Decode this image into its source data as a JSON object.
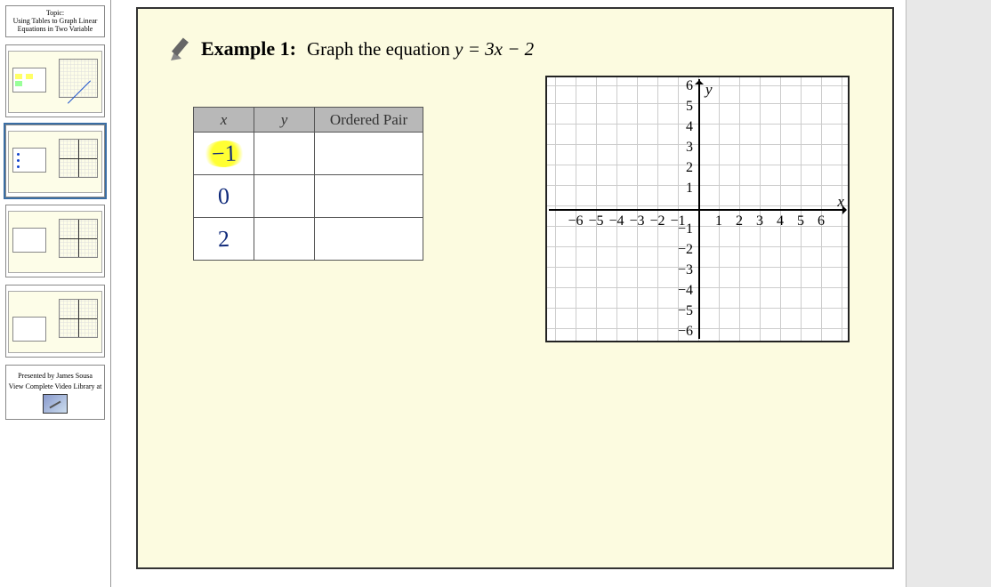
{
  "sidebar": {
    "topic_label": "Topic:",
    "topic_text": "Using Tables to Graph Linear Equations in Two Variable",
    "credits_presented_by": "Presented by James Sousa",
    "credits_view_library": "View Complete Video Library at"
  },
  "slide": {
    "example_label": "Example 1:",
    "example_prompt_prefix": "Graph the equation  ",
    "example_equation": "y = 3x − 2",
    "table": {
      "headers": {
        "x": "x",
        "y": "y",
        "ordered_pair": "Ordered Pair"
      },
      "rows": [
        {
          "x": "−1",
          "y": "",
          "pair": "",
          "highlight": true
        },
        {
          "x": "0",
          "y": "",
          "pair": "",
          "highlight": false
        },
        {
          "x": "2",
          "y": "",
          "pair": "",
          "highlight": false
        }
      ]
    },
    "grid": {
      "y_label": "y",
      "x_label": "x",
      "x_ticks_neg": [
        "−6",
        "−5",
        "−4",
        "−3",
        "−2",
        "−1"
      ],
      "x_ticks_pos": [
        "1",
        "2",
        "3",
        "4",
        "5",
        "6"
      ],
      "y_ticks_pos": [
        "1",
        "2",
        "3",
        "4",
        "5",
        "6"
      ],
      "y_ticks_neg": [
        "−1",
        "−2",
        "−3",
        "−4",
        "−5",
        "−6"
      ]
    }
  },
  "chart_data": {
    "type": "line",
    "title": "",
    "xlabel": "x",
    "ylabel": "y",
    "xlim": [
      -6.5,
      6.5
    ],
    "ylim": [
      -6.5,
      6.5
    ],
    "x_ticks": [
      -6,
      -5,
      -4,
      -3,
      -2,
      -1,
      1,
      2,
      3,
      4,
      5,
      6
    ],
    "y_ticks": [
      -6,
      -5,
      -4,
      -3,
      -2,
      -1,
      1,
      2,
      3,
      4,
      5,
      6
    ],
    "grid": true,
    "series": []
  }
}
